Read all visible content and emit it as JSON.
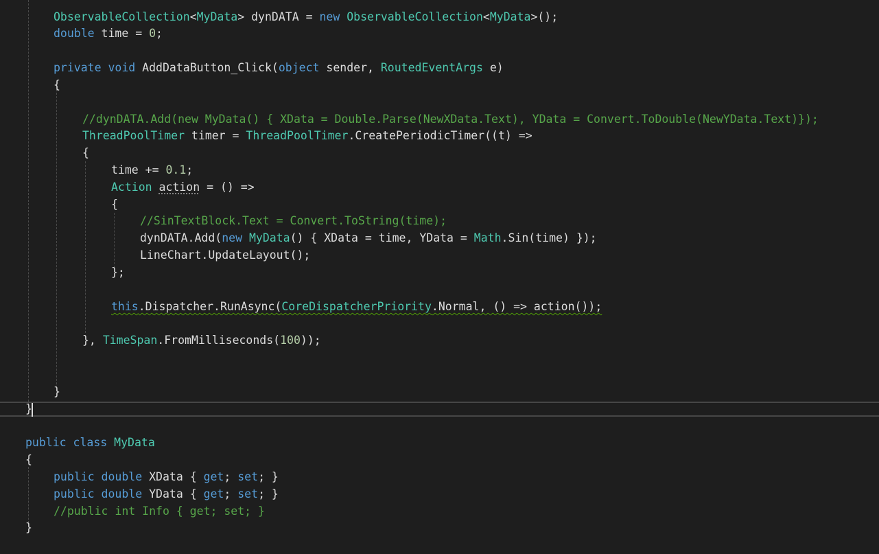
{
  "editor": {
    "lines": [
      {
        "id": "l1",
        "tokens": [
          {
            "t": "ObservableCollection",
            "c": "tok-type"
          },
          {
            "t": "<",
            "c": "tok-plain"
          },
          {
            "t": "MyData",
            "c": "tok-type"
          },
          {
            "t": "> dynDATA = ",
            "c": "tok-plain"
          },
          {
            "t": "new",
            "c": "tok-kw"
          },
          {
            "t": " ",
            "c": "tok-plain"
          },
          {
            "t": "ObservableCollection",
            "c": "tok-type"
          },
          {
            "t": "<",
            "c": "tok-plain"
          },
          {
            "t": "MyData",
            "c": "tok-type"
          },
          {
            "t": ">();",
            "c": "tok-plain"
          }
        ]
      },
      {
        "id": "l2",
        "tokens": [
          {
            "t": "double",
            "c": "tok-kw"
          },
          {
            "t": " time = ",
            "c": "tok-plain"
          },
          {
            "t": "0",
            "c": "tok-num"
          },
          {
            "t": ";",
            "c": "tok-plain"
          }
        ]
      },
      {
        "id": "l4",
        "tokens": [
          {
            "t": "private",
            "c": "tok-kw"
          },
          {
            "t": " ",
            "c": "tok-plain"
          },
          {
            "t": "void",
            "c": "tok-kw"
          },
          {
            "t": " AddDataButton_Click(",
            "c": "tok-plain"
          },
          {
            "t": "object",
            "c": "tok-kw"
          },
          {
            "t": " sender, ",
            "c": "tok-plain"
          },
          {
            "t": "RoutedEventArgs",
            "c": "tok-type"
          },
          {
            "t": " e)",
            "c": "tok-plain"
          }
        ]
      },
      {
        "id": "l5",
        "tokens": [
          {
            "t": "{",
            "c": "tok-plain"
          }
        ]
      },
      {
        "id": "l7",
        "tokens": [
          {
            "t": "//dynDATA.Add(new MyData() { XData = Double.Parse(NewXData.Text), YData = Convert.ToDouble(NewYData.Text)});",
            "c": "tok-cm"
          }
        ]
      },
      {
        "id": "l8",
        "tokens": [
          {
            "t": "ThreadPoolTimer",
            "c": "tok-type"
          },
          {
            "t": " timer = ",
            "c": "tok-plain"
          },
          {
            "t": "ThreadPoolTimer",
            "c": "tok-type"
          },
          {
            "t": ".CreatePeriodicTimer((t) =>",
            "c": "tok-plain"
          }
        ]
      },
      {
        "id": "l9",
        "tokens": [
          {
            "t": "{",
            "c": "tok-plain"
          }
        ]
      },
      {
        "id": "l10",
        "tokens": [
          {
            "t": "time += ",
            "c": "tok-plain"
          },
          {
            "t": "0.1",
            "c": "tok-num"
          },
          {
            "t": ";",
            "c": "tok-plain"
          }
        ]
      },
      {
        "id": "l11",
        "tokens": [
          {
            "t": "Action",
            "c": "tok-type"
          },
          {
            "t": " ",
            "c": "tok-plain"
          },
          {
            "t": "action",
            "c": "tok-plain dotted-hint"
          },
          {
            "t": " = () =>",
            "c": "tok-plain"
          }
        ]
      },
      {
        "id": "l12",
        "tokens": [
          {
            "t": "{",
            "c": "tok-plain"
          }
        ]
      },
      {
        "id": "l13",
        "tokens": [
          {
            "t": "//SinTextBlock.Text = Convert.ToString(time);",
            "c": "tok-cm"
          }
        ]
      },
      {
        "id": "l14",
        "tokens": [
          {
            "t": "dynDATA.Add(",
            "c": "tok-plain"
          },
          {
            "t": "new",
            "c": "tok-kw"
          },
          {
            "t": " ",
            "c": "tok-plain"
          },
          {
            "t": "MyData",
            "c": "tok-type"
          },
          {
            "t": "() { XData = time, YData = ",
            "c": "tok-plain"
          },
          {
            "t": "Math",
            "c": "tok-type"
          },
          {
            "t": ".Sin(time) });",
            "c": "tok-plain"
          }
        ]
      },
      {
        "id": "l15",
        "tokens": [
          {
            "t": "LineChart.UpdateLayout();",
            "c": "tok-plain"
          }
        ]
      },
      {
        "id": "l16",
        "tokens": [
          {
            "t": "};",
            "c": "tok-plain"
          }
        ]
      },
      {
        "id": "l18",
        "tokens": [
          {
            "t": "this",
            "c": "tok-kw squiggle"
          },
          {
            "t": ".Dispatcher.RunAsync(",
            "c": "tok-plain squiggle"
          },
          {
            "t": "CoreDispatcherPriority",
            "c": "tok-type squiggle"
          },
          {
            "t": ".Normal, () => action());",
            "c": "tok-plain squiggle"
          }
        ]
      },
      {
        "id": "l20",
        "tokens": [
          {
            "t": "}, ",
            "c": "tok-plain"
          },
          {
            "t": "TimeSpan",
            "c": "tok-type"
          },
          {
            "t": ".FromMilliseconds(",
            "c": "tok-plain"
          },
          {
            "t": "100",
            "c": "tok-num"
          },
          {
            "t": "));",
            "c": "tok-plain"
          }
        ]
      },
      {
        "id": "l23",
        "tokens": [
          {
            "t": "}",
            "c": "tok-plain"
          }
        ]
      },
      {
        "id": "l24",
        "tokens": [
          {
            "t": "}",
            "c": "tok-plain"
          }
        ]
      },
      {
        "id": "l26",
        "tokens": [
          {
            "t": "public",
            "c": "tok-kw"
          },
          {
            "t": " ",
            "c": "tok-plain"
          },
          {
            "t": "class",
            "c": "tok-kw"
          },
          {
            "t": " ",
            "c": "tok-plain"
          },
          {
            "t": "MyData",
            "c": "tok-type"
          }
        ]
      },
      {
        "id": "l27",
        "tokens": [
          {
            "t": "{",
            "c": "tok-plain"
          }
        ]
      },
      {
        "id": "l28",
        "tokens": [
          {
            "t": "public",
            "c": "tok-kw"
          },
          {
            "t": " ",
            "c": "tok-plain"
          },
          {
            "t": "double",
            "c": "tok-kw"
          },
          {
            "t": " XData { ",
            "c": "tok-plain"
          },
          {
            "t": "get",
            "c": "tok-kw"
          },
          {
            "t": "; ",
            "c": "tok-plain"
          },
          {
            "t": "set",
            "c": "tok-kw"
          },
          {
            "t": "; }",
            "c": "tok-plain"
          }
        ]
      },
      {
        "id": "l29",
        "tokens": [
          {
            "t": "public",
            "c": "tok-kw"
          },
          {
            "t": " ",
            "c": "tok-plain"
          },
          {
            "t": "double",
            "c": "tok-kw"
          },
          {
            "t": " YData { ",
            "c": "tok-plain"
          },
          {
            "t": "get",
            "c": "tok-kw"
          },
          {
            "t": "; ",
            "c": "tok-plain"
          },
          {
            "t": "set",
            "c": "tok-kw"
          },
          {
            "t": "; }",
            "c": "tok-plain"
          }
        ]
      },
      {
        "id": "l30",
        "tokens": [
          {
            "t": "//public int Info { get; set; }",
            "c": "tok-cm"
          }
        ]
      },
      {
        "id": "l31",
        "tokens": [
          {
            "t": "}",
            "c": "tok-plain"
          }
        ]
      }
    ]
  }
}
